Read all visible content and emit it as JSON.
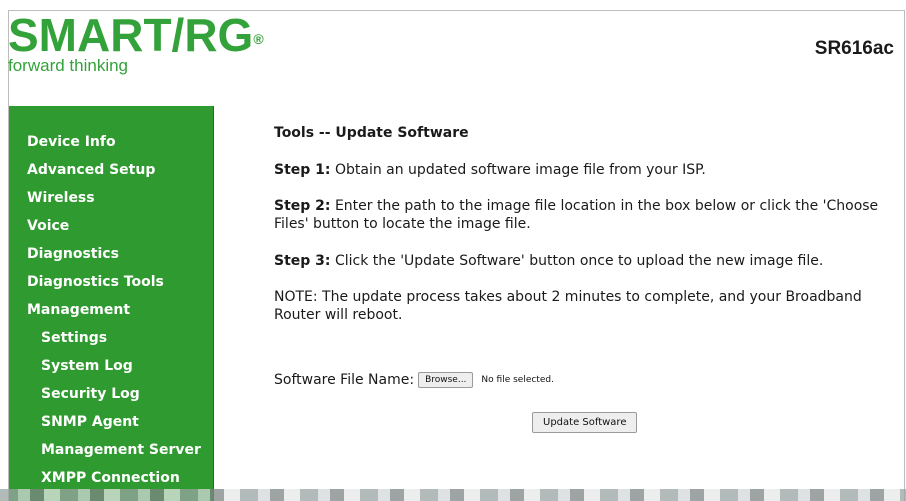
{
  "header": {
    "logo_text": "SMART/RG",
    "logo_reg": "®",
    "tagline": "forward thinking",
    "model": "SR616ac"
  },
  "sidebar": {
    "items": [
      {
        "label": "Device Info"
      },
      {
        "label": "Advanced Setup"
      },
      {
        "label": "Wireless"
      },
      {
        "label": "Voice"
      },
      {
        "label": "Diagnostics"
      },
      {
        "label": "Diagnostics Tools"
      },
      {
        "label": "Management"
      },
      {
        "label": "Settings"
      },
      {
        "label": "System Log"
      },
      {
        "label": "Security Log"
      },
      {
        "label": "SNMP Agent"
      },
      {
        "label": "Management Server"
      },
      {
        "label": "XMPP Connection"
      }
    ]
  },
  "main": {
    "title": "Tools -- Update Software",
    "step1_label": "Step 1:",
    "step1_text": " Obtain an updated software image file from your ISP.",
    "step2_label": "Step 2:",
    "step2_text": " Enter the path to the image file location in the box below or click the 'Choose Files' button to locate the image file.",
    "step3_label": "Step 3:",
    "step3_text": " Click the 'Update Software' button once to upload the new image file.",
    "note": "NOTE: The update process takes about 2 minutes to complete, and your Broadband Router will reboot.",
    "file_label": "Software File Name:",
    "browse_label": "Browse...",
    "no_file_text": "No file selected.",
    "update_label": "Update Software"
  },
  "colors": {
    "brand_green": "#34a23a",
    "sidebar_green": "#2f9a2f"
  }
}
